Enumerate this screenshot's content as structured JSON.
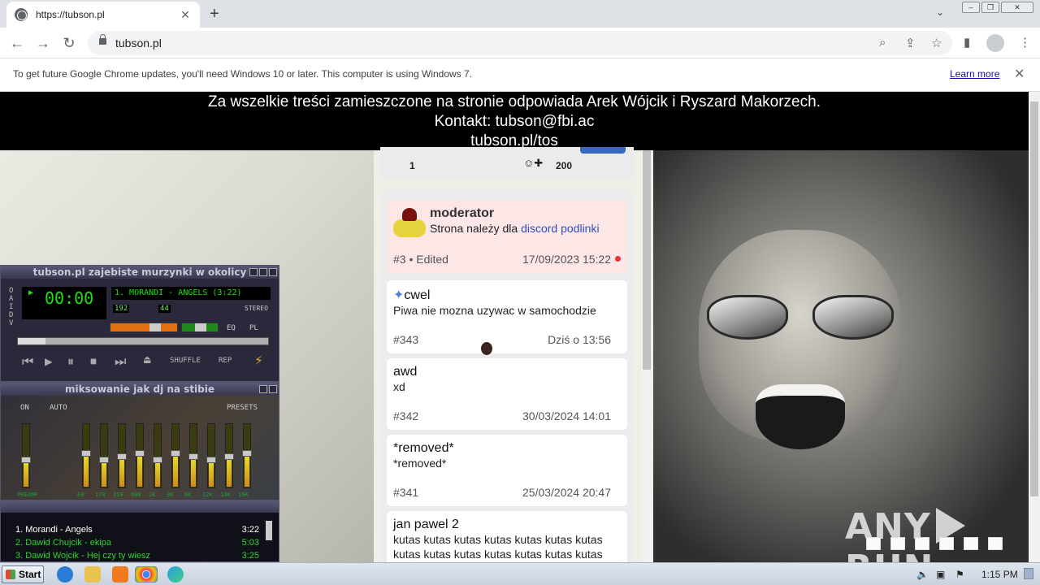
{
  "browser": {
    "tab_title": "https://tubson.pl",
    "tab_close": "✕",
    "new_tab": "+",
    "tab_search": "⌄",
    "url": "tubson.pl"
  },
  "infobar": {
    "message": "To get future Google Chrome updates, you'll need Windows 10 or later. This computer is using Windows 7.",
    "learn_more": "Learn more",
    "close": "✕"
  },
  "notice": {
    "line1": "Za wszelkie treści zamieszczone na stronie odpowiada Arek Wójcik i Ryszard Makorzech.",
    "line2": "Kontakt: tubson@fbi.ac",
    "line3": "tubson.pl/tos"
  },
  "prev_post": {
    "likes": "1",
    "score": "200"
  },
  "posts": [
    {
      "author": "moderator",
      "body_text": "Strona należy dla ",
      "body_link": "discord podlinki",
      "meta": "#3 • Edited",
      "date": "17/09/2023 15:22"
    },
    {
      "author": "cwel",
      "body": "Piwa nie mozna uzywac w samochodzie",
      "meta": "#343",
      "date": "Dziś o 13:56"
    },
    {
      "author": "awd",
      "body": "xd",
      "meta": "#342",
      "date": "30/03/2024 14:01"
    },
    {
      "author": "*removed*",
      "body": "*removed*",
      "meta": "#341",
      "date": "25/03/2024 20:47"
    },
    {
      "author": "jan pawel 2",
      "body": "kutas kutas kutas kutas kutas kutas kutas kutas kutas kutas kutas kutas kutas kutas"
    }
  ],
  "winamp": {
    "title": "tubson.pl zajebiste murzynki w okolicy",
    "time": "00:00",
    "track": "1. MORANDI - ANGELS (3:22)",
    "kbps": "192",
    "khz": "44",
    "stereo": "STEREO",
    "eq_label": "EQ",
    "pl_label": "PL",
    "shuffle": "SHUFFLE",
    "repeat": "REP",
    "eq_title": "miksowanie jak dj na stibie",
    "eq_on": "ON",
    "eq_auto": "AUTO",
    "eq_presets": "PRESETS",
    "eq_freqs": [
      "PREAMP",
      "60",
      "170",
      "310",
      "600",
      "1K",
      "3K",
      "6K",
      "12K",
      "14K",
      "16K"
    ],
    "eq_levels": [
      0.45,
      0.55,
      0.45,
      0.5,
      0.55,
      0.45,
      0.55,
      0.5,
      0.45,
      0.5,
      0.55
    ],
    "playlist": [
      {
        "title": "1. Morandi - Angels",
        "time": "3:22"
      },
      {
        "title": "2. Dawid Chujcik - ekipa",
        "time": "5:03"
      },
      {
        "title": "3. Dawid Wojcik - Hej czy ty wiesz",
        "time": "3:25"
      }
    ]
  },
  "watermark": {
    "left": "ANY",
    "right": "RUN"
  },
  "taskbar": {
    "start": "Start",
    "clock": "1:15 PM"
  },
  "colors": {
    "notice_bg": "#000000",
    "mod_post_bg": "#fde6e6",
    "link": "#2f4fbd",
    "winamp_green": "#1fe014"
  }
}
